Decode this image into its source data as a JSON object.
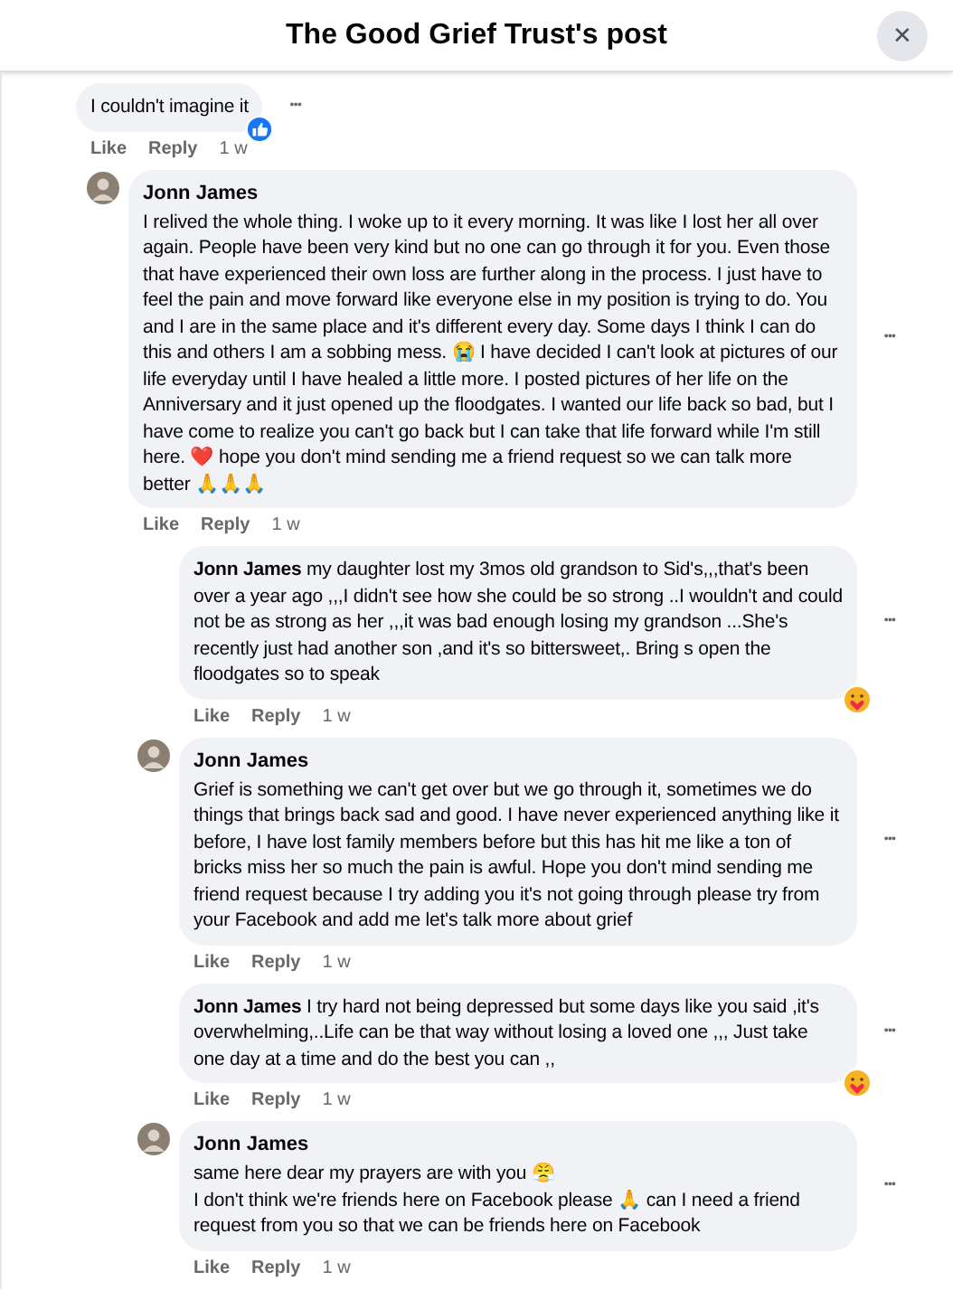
{
  "header": {
    "title": "The Good Grief Trust's post",
    "close": "✕"
  },
  "comments": [
    {
      "kind": "plain",
      "avatar": false,
      "text": "I couldn't imagine it",
      "reaction": {
        "kind": "like"
      },
      "actions": [
        "Like",
        "Reply"
      ],
      "time": "1 w",
      "more": "•••"
    },
    {
      "kind": "named",
      "avatar": true,
      "author": "Jonn James",
      "text": "I relived the whole thing. I woke up to it every morning. It was like I lost her all over again. People have been very kind but no one can go through it for you. Even those that have experienced their own loss are further along in the process. I just have to feel the pain and move forward like everyone else in my position is trying to do. You and I are in the same place and it's different every day. Some days I think I can do this and others I am a sobbing mess. 😭 I have decided I can't look at pictures of our life everyday until I have healed a little more. I posted pictures of her life on the Anniversary and it just opened up the floodgates. I wanted our life back so bad, but I have come to realize you can't go back but I can take that life forward while I'm still here. ❤️ hope you don't mind sending me a friend request so we can talk more better 🙏🙏🙏",
      "actions": [
        "Like",
        "Reply"
      ],
      "time": "1 w",
      "more": "•••",
      "children": [
        {
          "kind": "inline_name",
          "avatar": false,
          "author": "Jonn James",
          "text": "my daughter lost my 3mos old grandson to Sid's,,,that's been over a year ago ,,,I didn't see how she could be so strong ..I wouldn't and could not be as strong as her ,,,it was bad enough losing my grandson ...She's recently just had another son ,and it's so bittersweet,. Bring s open the floodgates so to speak",
          "reaction": {
            "kind": "care"
          },
          "actions": [
            "Like",
            "Reply"
          ],
          "time": "1 w",
          "more": "•••"
        },
        {
          "kind": "named",
          "avatar": true,
          "author": "Jonn James",
          "text": "Grief is something we can't get over but we go through it, sometimes we do things that brings back sad and good. I have never experienced anything like it before, I have lost family members before but this has hit me like a ton of bricks miss her so much the pain is awful. Hope you don't mind sending me friend request because I try adding you it's not going through please try from your Facebook and add me let's talk more about grief",
          "actions": [
            "Like",
            "Reply"
          ],
          "time": "1 w",
          "more": "•••"
        },
        {
          "kind": "inline_name",
          "avatar": false,
          "author": "Jonn James",
          "text": "I try hard not being depressed but some days like you said ,it's overwhelming,..Life can be that way without losing a loved one ,,, Just take one day at a time and do the best you can ,,",
          "reaction": {
            "kind": "care"
          },
          "actions": [
            "Like",
            "Reply"
          ],
          "time": "1 w",
          "more": "•••"
        },
        {
          "kind": "named",
          "avatar": true,
          "author": "Jonn James",
          "text": "same here dear my prayers are with you 😤\nI don't think we're friends here on Facebook please 🙏 can I need a friend request from you so that we can be friends here on Facebook",
          "actions": [
            "Like",
            "Reply"
          ],
          "time": "1 w",
          "more": "•••"
        }
      ]
    }
  ]
}
